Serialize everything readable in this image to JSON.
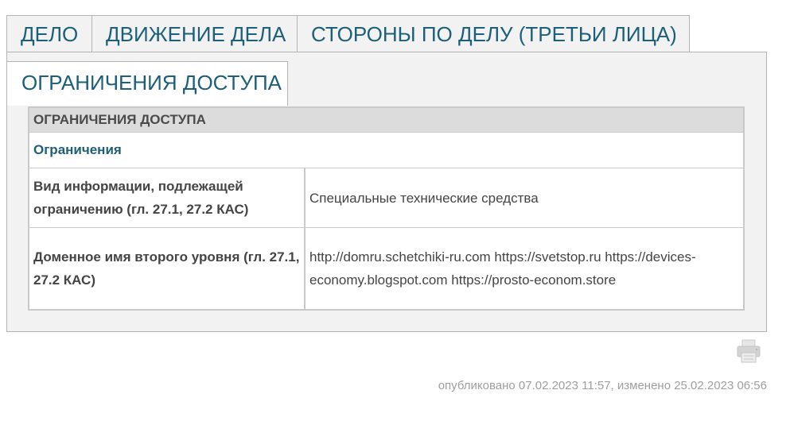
{
  "tabs": {
    "delo": "ДЕЛО",
    "dvizhenie": "ДВИЖЕНИЕ ДЕЛА",
    "storony": "СТОРОНЫ ПО ДЕЛУ (ТРЕТЬИ ЛИЦА)",
    "ogranicheniya": "ОГРАНИЧЕНИЯ ДОСТУПА"
  },
  "table": {
    "header": "ОГРАНИЧЕНИЯ ДОСТУПА",
    "subheader": "Ограничения",
    "rows": [
      {
        "label": "Вид информации, подлежащей ограничению (гл. 27.1, 27.2 КАС)",
        "value": "Специальные технические средства"
      },
      {
        "label": "Доменное имя второго уровня (гл. 27.1, 27.2 КАС)",
        "value": "http://domru.schetchiki-ru.com https://svetstop.ru https://devices-economy.blogspot.com https://prosto-econom.store"
      }
    ]
  },
  "footer": {
    "meta": "опубликовано 07.02.2023 11:57, изменено 25.02.2023 06:56",
    "print_icon": "printer-icon"
  },
  "colors": {
    "tab_text": "#1b5f7a",
    "border": "#b3b3b3",
    "panel_bg": "#f2f2f2",
    "header_bg": "#dcdcdc",
    "meta_text": "#9e9e9e"
  }
}
